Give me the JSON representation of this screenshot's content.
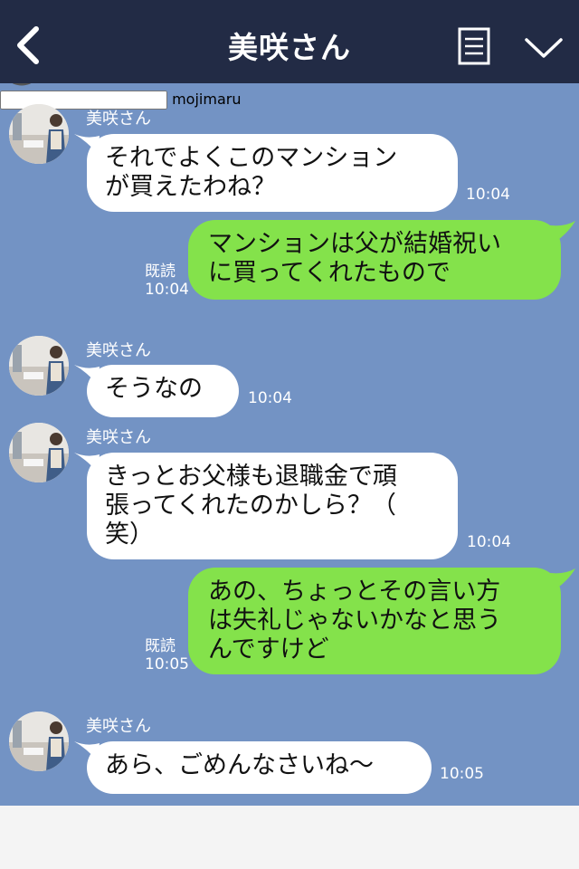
{
  "header": {
    "title": "美咲さん",
    "back_icon": "chevron-left-icon",
    "menu_icon": "note-list-icon",
    "expand_icon": "chevron-down-icon"
  },
  "messages": [
    {
      "sender": "美咲さん",
      "direction": "in",
      "text": "それでよくこのマンション\nが買えたわね？",
      "time": "10:04"
    },
    {
      "direction": "out",
      "text": "マンションは父が結婚祝い\nに買ってくれたもので",
      "read": "既読",
      "time": "10:04"
    },
    {
      "sender": "美咲さん",
      "direction": "in",
      "text": "そうなの",
      "time": "10:04"
    },
    {
      "sender": "美咲さん",
      "direction": "in",
      "text": "きっとお父様も退職金で頑\n張ってくれたのかしら？（\n笑）",
      "time": "10:04"
    },
    {
      "direction": "out",
      "text": "あの、ちょっとその言い方\nは失礼じゃないかなと思う\nんですけど",
      "read": "既読",
      "time": "10:05"
    },
    {
      "sender": "美咲さん",
      "direction": "in",
      "text": "あら、ごめんなさいね～",
      "time": "10:05"
    }
  ],
  "footer": {
    "add_icon": "plus-icon",
    "emoji_icon": "smiley-icon",
    "input_placeholder": "",
    "watermark": "mojimaru",
    "call_icon": "phone-icon"
  },
  "colors": {
    "header_bg": "#222b45",
    "chat_bg": "#7393c4",
    "incoming_bubble": "#ffffff",
    "outgoing_bubble": "#84e24b",
    "call_button": "#4a8bf0"
  }
}
